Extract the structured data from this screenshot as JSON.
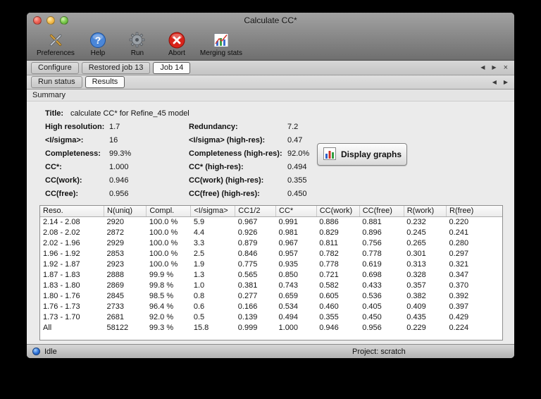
{
  "window": {
    "title": "Calculate CC*"
  },
  "colors": {
    "status_led_blue": "#2b6fd6",
    "abort_red": "#d8241a",
    "help_blue": "#4a86d8",
    "close_light": "#ec6053",
    "minimize_light": "#f5bf50",
    "zoom_light": "#79c94c"
  },
  "toolbar": {
    "items": [
      {
        "label": "Preferences",
        "icon": "preferences-tools-icon"
      },
      {
        "label": "Help",
        "icon": "help-icon"
      },
      {
        "label": "Run",
        "icon": "run-gear-icon"
      },
      {
        "label": "Abort",
        "icon": "abort-icon"
      },
      {
        "label": "Merging stats",
        "icon": "merging-stats-icon"
      }
    ]
  },
  "job_tabs": {
    "items": [
      {
        "label": "Configure",
        "selected": false
      },
      {
        "label": "Restored job 13",
        "selected": false
      },
      {
        "label": "Job 14",
        "selected": true
      }
    ]
  },
  "view_tabs": {
    "items": [
      {
        "label": "Run status",
        "selected": false
      },
      {
        "label": "Results",
        "selected": true
      }
    ]
  },
  "tab_nav": {
    "back": "◀",
    "forward": "▶",
    "close": "×"
  },
  "section": {
    "label": "Summary"
  },
  "summary": {
    "title_label": "Title:",
    "title_value": "calculate CC* for Refine_45 model",
    "rows": [
      {
        "label1": "High resolution:",
        "value1": "1.7",
        "label2": "Redundancy:",
        "value2": "7.2"
      },
      {
        "label1": "<I/sigma>:",
        "value1": "16",
        "label2": "<I/sigma> (high-res):",
        "value2": "0.47"
      },
      {
        "label1": "Completeness:",
        "value1": "99.3%",
        "label2": "Completeness (high-res):",
        "value2": "92.0%"
      },
      {
        "label1": "CC*:",
        "value1": "1.000",
        "label2": "CC* (high-res):",
        "value2": "0.494"
      },
      {
        "label1": "CC(work):",
        "value1": "0.946",
        "label2": "CC(work) (high-res):",
        "value2": "0.355"
      },
      {
        "label1": "CC(free):",
        "value1": "0.956",
        "label2": "CC(free) (high-res):",
        "value2": "0.450"
      }
    ],
    "display_graphs_button": "Display graphs"
  },
  "table": {
    "columns": [
      "Reso.",
      "N(uniq)",
      "Compl.",
      "<I/sigma>",
      "CC1/2",
      "CC*",
      "CC(work)",
      "CC(free)",
      "R(work)",
      "R(free)"
    ],
    "rows": [
      [
        "2.14 - 2.08",
        "2920",
        "100.0 %",
        "5.9",
        "0.967",
        "0.991",
        "0.886",
        "0.881",
        "0.232",
        "0.220"
      ],
      [
        "2.08 - 2.02",
        "2872",
        "100.0 %",
        "4.4",
        "0.926",
        "0.981",
        "0.829",
        "0.896",
        "0.245",
        "0.241"
      ],
      [
        "2.02 - 1.96",
        "2929",
        "100.0 %",
        "3.3",
        "0.879",
        "0.967",
        "0.811",
        "0.756",
        "0.265",
        "0.280"
      ],
      [
        "1.96 - 1.92",
        "2853",
        "100.0 %",
        "2.5",
        "0.846",
        "0.957",
        "0.782",
        "0.778",
        "0.301",
        "0.297"
      ],
      [
        "1.92 - 1.87",
        "2923",
        "100.0 %",
        "1.9",
        "0.775",
        "0.935",
        "0.778",
        "0.619",
        "0.313",
        "0.321"
      ],
      [
        "1.87 - 1.83",
        "2888",
        "99.9 %",
        "1.3",
        "0.565",
        "0.850",
        "0.721",
        "0.698",
        "0.328",
        "0.347"
      ],
      [
        "1.83 - 1.80",
        "2869",
        "99.8 %",
        "1.0",
        "0.381",
        "0.743",
        "0.582",
        "0.433",
        "0.357",
        "0.370"
      ],
      [
        "1.80 - 1.76",
        "2845",
        "98.5 %",
        "0.8",
        "0.277",
        "0.659",
        "0.605",
        "0.536",
        "0.382",
        "0.392"
      ],
      [
        "1.76 - 1.73",
        "2733",
        "96.4 %",
        "0.6",
        "0.166",
        "0.534",
        "0.460",
        "0.405",
        "0.409",
        "0.397"
      ],
      [
        "1.73 - 1.70",
        "2681",
        "92.0 %",
        "0.5",
        "0.139",
        "0.494",
        "0.355",
        "0.450",
        "0.435",
        "0.429"
      ],
      [
        "All",
        "58122",
        "99.3 %",
        "15.8",
        "0.999",
        "1.000",
        "0.946",
        "0.956",
        "0.229",
        "0.224"
      ]
    ]
  },
  "status_bar": {
    "status": "Idle",
    "project": "Project: scratch"
  }
}
